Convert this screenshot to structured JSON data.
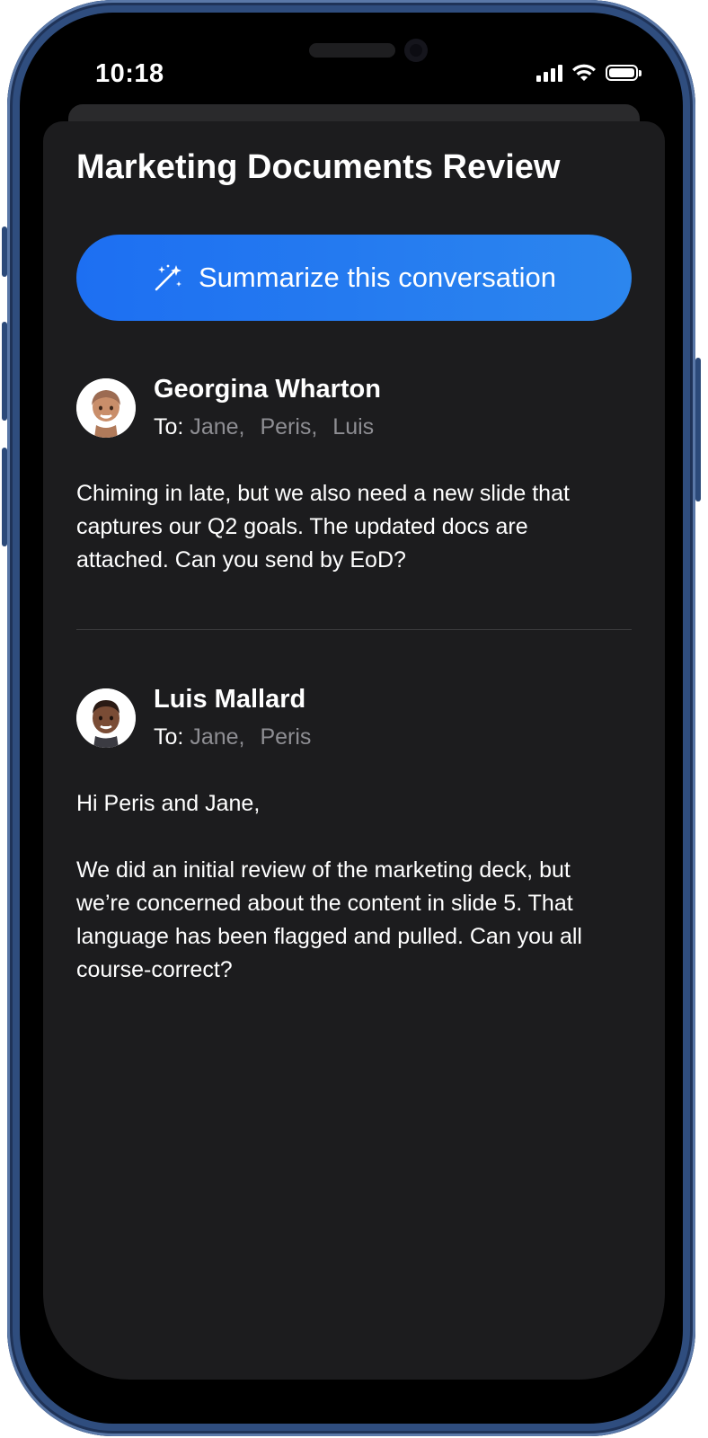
{
  "status_bar": {
    "time": "10:18"
  },
  "thread": {
    "title": "Marketing Documents Review",
    "summarize_label": "Summarize this conversation",
    "to_label": "To:",
    "messages": [
      {
        "sender": "Georgina Wharton",
        "recipients": [
          "Jane,",
          "Peris,",
          "Luis"
        ],
        "paragraphs": [
          "Chiming in late, but we also need a new slide that captures our Q2 goals. The updated docs are attached. Can you send by EoD?"
        ]
      },
      {
        "sender": "Luis Mallard",
        "recipients": [
          "Jane,",
          "Peris"
        ],
        "paragraphs": [
          "Hi Peris and Jane,",
          "We did an initial review of the marketing deck, but we’re concerned about the content in slide 5. That language has been flagged and pulled. Can you all course-correct?"
        ]
      }
    ]
  },
  "colors": {
    "accent": "#1d6ff2",
    "sheet_background": "#1c1c1e",
    "secondary_text": "#8e8e93",
    "chassis": "#2f4d7e"
  },
  "icons": {
    "summarize": "sparkles-icon",
    "signal": "cellular-signal-icon",
    "wifi": "wifi-icon",
    "battery": "battery-icon"
  },
  "battery_level": 1.0
}
